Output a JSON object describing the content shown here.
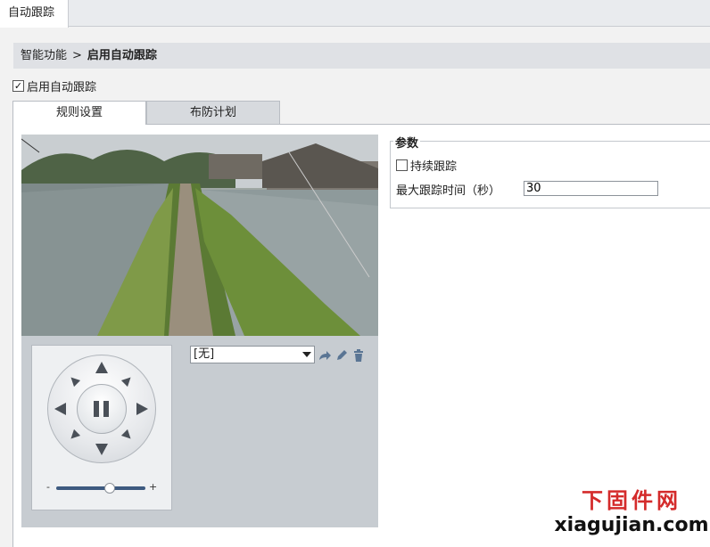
{
  "top_tab": {
    "label": "自动跟踪"
  },
  "breadcrumb": {
    "parent": "智能功能",
    "separator": ">",
    "current": "启用自动跟踪"
  },
  "enable": {
    "label": "启用自动跟踪",
    "checked": true
  },
  "tabs": [
    {
      "label": "规则设置",
      "active": true
    },
    {
      "label": "布防计划",
      "active": false
    }
  ],
  "ptz": {
    "zoom_minus": "-",
    "zoom_plus": "+",
    "zoom_level": 0.6,
    "preset_value": "[无]",
    "icons": [
      "pause-icon",
      "arrow-up-icon",
      "arrow-down-icon",
      "arrow-left-icon",
      "arrow-right-icon",
      "call-preset-icon",
      "edit-icon",
      "delete-icon"
    ]
  },
  "params": {
    "legend": "参数",
    "continuous_label": "持续跟踪",
    "continuous_checked": false,
    "max_time_label": "最大跟踪时间（秒）",
    "max_time_value": "30"
  },
  "watermark": {
    "cn": "下固件网",
    "en": "xiagujian.com"
  },
  "colors": {
    "accent": "#3d5a80",
    "watermark_red": "#d42b2b"
  }
}
